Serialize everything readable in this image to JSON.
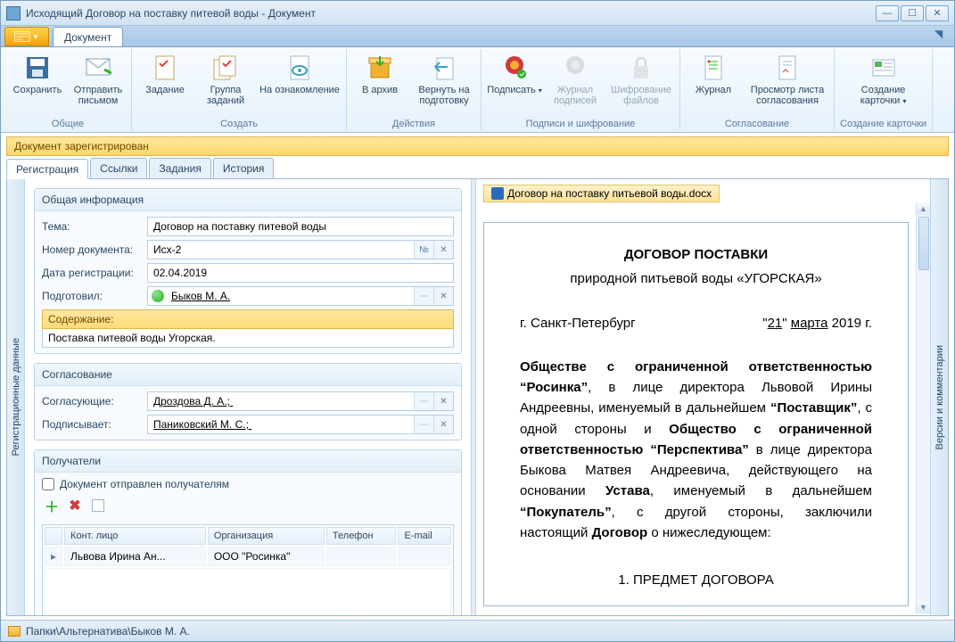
{
  "window": {
    "title": "Исходящий Договор на поставку питевой воды - Документ"
  },
  "ribbon": {
    "tab": "Документ",
    "groups": {
      "g1": {
        "label": "Общие",
        "save": "Сохранить",
        "send": "Отправить письмом"
      },
      "g2": {
        "label": "Создать",
        "task": "Задание",
        "taskgroup": "Группа заданий",
        "review": "На ознакомление"
      },
      "g3": {
        "label": "Действия",
        "archive": "В архив",
        "back": "Вернуть на подготовку"
      },
      "g4": {
        "label": "Подписи и шифрование",
        "sign": "Подписать",
        "siglog": "Журнал подписей",
        "encrypt": "Шифрование файлов"
      },
      "g5": {
        "label": "Согласование",
        "log": "Журнал",
        "sheet": "Просмотр листа согласования"
      },
      "g6": {
        "label": "Создание карточки",
        "card": "Создание карточки"
      }
    }
  },
  "statusStrip": "Документ зарегистрирован",
  "tabs": {
    "reg": "Регистрация",
    "links": "Ссылки",
    "tasks": "Задания",
    "history": "История"
  },
  "sideLeft": "Регистрационные данные",
  "sideRight": "Версии и комментарии",
  "form": {
    "generalHdr": "Общая информация",
    "themeLbl": "Тема:",
    "theme": "Договор на поставку питевой воды",
    "numLbl": "Номер документа:",
    "num": "Исх-2",
    "numBtn": "№",
    "dateLbl": "Дата регистрации:",
    "date": "02.04.2019",
    "prepLbl": "Подготовил:",
    "prep": "Быков М. А.",
    "descLbl": "Содержание:",
    "desc": "Поставка питевой воды Угорская.",
    "approvHdr": "Согласование",
    "approversLbl": "Согласующие:",
    "approvers": "Дроздова Д. А.; ",
    "signerLbl": "Подписывает:",
    "signer": "Паниковский М. С.; ",
    "recipHdr": "Получатели",
    "sentChk": "Документ отправлен получателям",
    "cols": {
      "contact": "Конт. лицо",
      "org": "Организация",
      "phone": "Телефон",
      "email": "E-mail"
    },
    "rows": [
      {
        "contact": "Львова Ирина Ан...",
        "org": "ООО \"Росинка\"",
        "phone": "",
        "email": ""
      }
    ]
  },
  "attachment": "Договор на поставку питьевой воды.docx",
  "doc": {
    "title": "ДОГОВОР ПОСТАВКИ",
    "sub": "природной питьевой воды «УГОРСКАЯ»",
    "city": "г. Санкт-Петербург",
    "date_q": "\"",
    "date_d": "21",
    "date_m": "марта",
    "date_rest": " 2019 г.",
    "p1a": "Обществе с ограниченной ответственностью “Росинка”",
    "p1b": ", в лице директора Львовой Ирины Андреевны, именуемый в дальнейшем ",
    "p1c": "“Поставщик”",
    "p1d": ", с одной стороны и ",
    "p1e": "Общество с ограниченной ответственностью “Перспектива”",
    "p1f": " в лице директора Быкова Матвея Андреевича, действующего на основании ",
    "p1g": "Устава",
    "p1h": ", именуемый в дальнейшем ",
    "p1i": "“Покупатель”",
    "p1j": ", с другой стороны, заключили настоящий ",
    "p1k": "Договор",
    "p1l": " о нижеследующем:",
    "sec1": "1. ПРЕДМЕТ ДОГОВОРА"
  },
  "footer": "Папки\\Альтернатива\\Быков М. А."
}
